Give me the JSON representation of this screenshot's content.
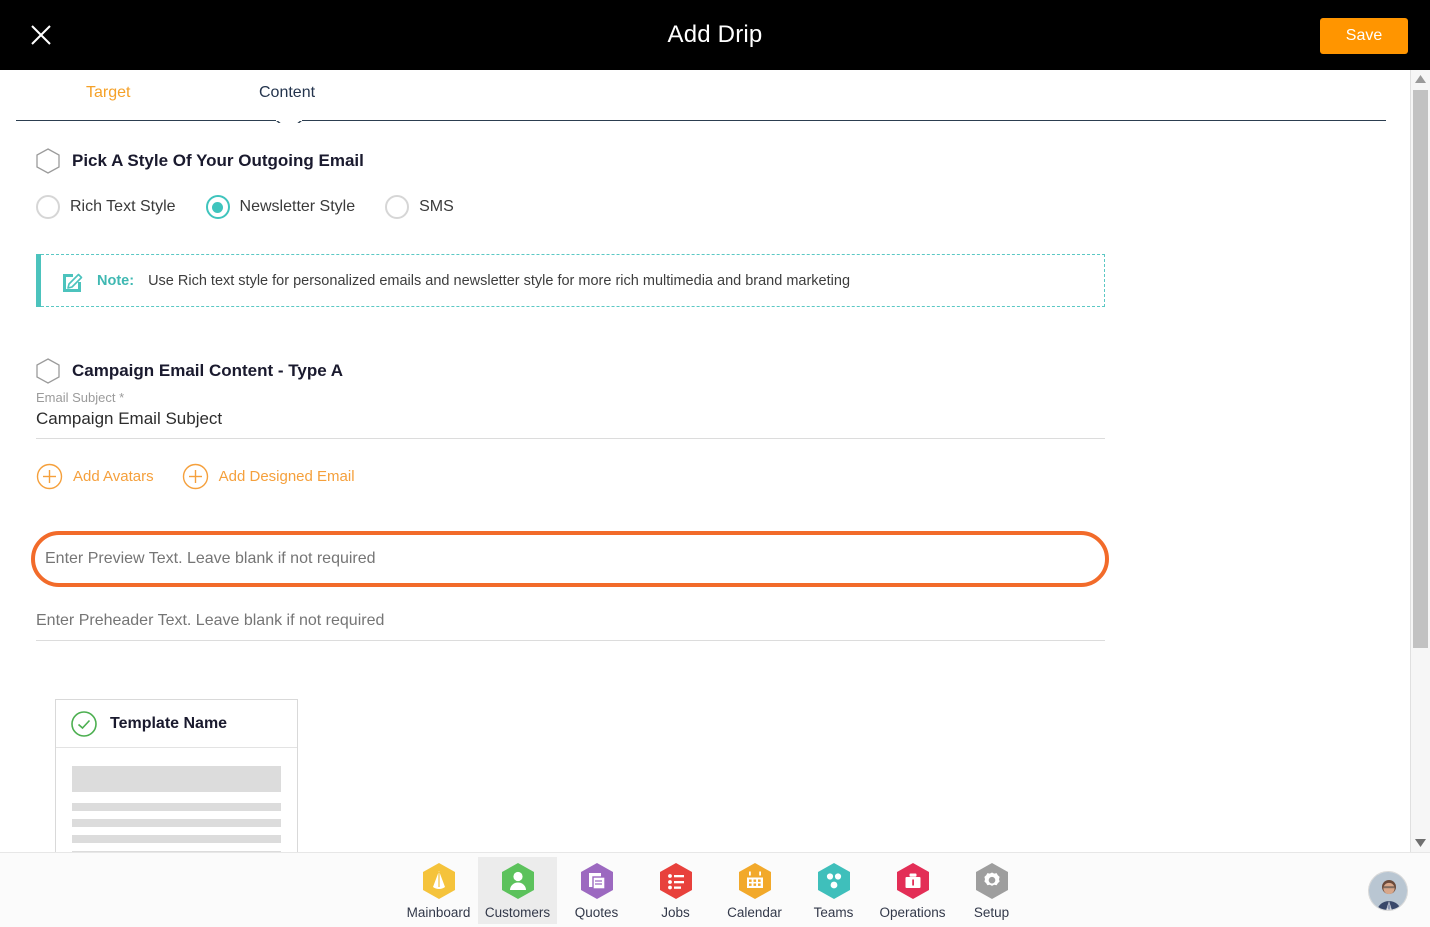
{
  "header": {
    "title": "Add Drip",
    "close_icon": "close-icon",
    "save_label": "Save"
  },
  "tabs": [
    {
      "label": "Target",
      "active": false
    },
    {
      "label": "Content",
      "active": true
    }
  ],
  "sections": {
    "style": {
      "title": "Pick A Style Of Your Outgoing Email",
      "options": [
        {
          "label": "Rich Text Style",
          "selected": false
        },
        {
          "label": "Newsletter Style",
          "selected": true
        },
        {
          "label": "SMS",
          "selected": false
        }
      ],
      "note": {
        "icon": "edit-pencil-icon",
        "label": "Note:",
        "text": "Use Rich text style for personalized emails and newsletter style for more rich multimedia and brand marketing"
      }
    },
    "campaign": {
      "title": "Campaign Email Content - Type A",
      "email_subject_label": "Email Subject *",
      "email_subject_value": "Campaign Email Subject",
      "add_links": [
        {
          "label": "Add Avatars",
          "icon": "plus-circle-icon"
        },
        {
          "label": "Add Designed Email",
          "icon": "plus-circle-icon"
        }
      ],
      "preview_placeholder": "Enter Preview Text. Leave blank if not required",
      "preview_value": "",
      "preheader_placeholder": "Enter Preheader Text. Leave blank if not required",
      "preheader_value": "",
      "template_card": {
        "name": "Template Name",
        "status_icon": "check-circle-icon"
      }
    }
  },
  "bottom_nav": [
    {
      "label": "Mainboard",
      "icon": "mainboard-icon",
      "color": "#F5C33B",
      "active": false
    },
    {
      "label": "Customers",
      "icon": "customers-icon",
      "color": "#5CC25C",
      "active": true
    },
    {
      "label": "Quotes",
      "icon": "quotes-icon",
      "color": "#9C69C0",
      "active": false
    },
    {
      "label": "Jobs",
      "icon": "jobs-icon",
      "color": "#E8413C",
      "active": false
    },
    {
      "label": "Calendar",
      "icon": "calendar-icon",
      "color": "#F2A92B",
      "active": false
    },
    {
      "label": "Teams",
      "icon": "teams-icon",
      "color": "#3FBFBB",
      "active": false
    },
    {
      "label": "Operations",
      "icon": "operations-icon",
      "color": "#E32E56",
      "active": false
    },
    {
      "label": "Setup",
      "icon": "setup-icon",
      "color": "#9E9E9E",
      "active": false
    }
  ],
  "user_avatar": "user-avatar",
  "colors": {
    "accent_orange": "#FF9500",
    "highlight_orange": "#F26B2A",
    "teal": "#3FC4BD",
    "tab_active": "#24344D",
    "tab_inactive": "#F5A128"
  },
  "scrollbar": {
    "up_icon": "scroll-up-arrow-icon",
    "down_icon": "scroll-down-arrow-icon"
  }
}
